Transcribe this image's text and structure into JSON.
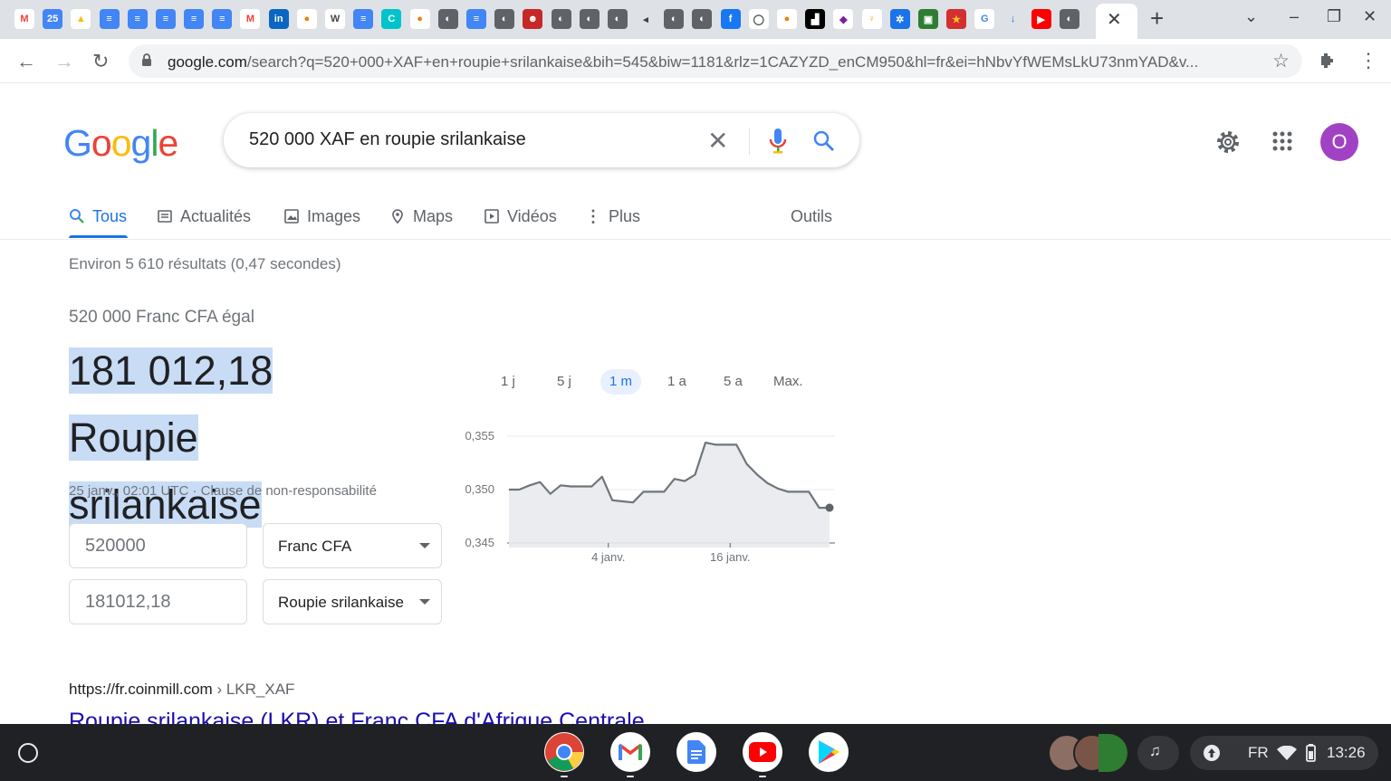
{
  "browser": {
    "url_host": "google.com",
    "url_rest": "/search?q=520+000+XAF+en+roupie+srilankaise&bih=545&biw=1181&rlz=1CAZYZD_enCM950&hl=fr&ei=hNbvYfWEMsLkU73nmYAD&v...",
    "favicons": [
      "gmail-icon",
      "calendar-icon",
      "drive-icon",
      "docs-icon",
      "docs-icon",
      "docs-icon",
      "docs-icon",
      "docs-icon",
      "gmail-icon",
      "linkedin-icon",
      "app-icon",
      "wordpress-icon",
      "docs-icon",
      "canva-icon",
      "app-icon",
      "globe-icon",
      "docs-icon",
      "globe-icon",
      "ghost-icon",
      "globe-icon",
      "globe-icon",
      "globe-icon",
      "audio-icon",
      "globe-icon",
      "globe-icon",
      "facebook-icon",
      "cycle-icon",
      "app-icon",
      "puzzle-icon",
      "diamond-icon",
      "figure-icon",
      "gear-icon",
      "photo-icon",
      "flag-icon",
      "google-icon",
      "download-icon",
      "youtube-icon",
      "globe-icon"
    ]
  },
  "search": {
    "logo": "Google",
    "query": "520 000 XAF en roupie srilankaise",
    "avatar_letter": "O",
    "tabs": [
      {
        "label": "Tous",
        "icon": "search-icon"
      },
      {
        "label": "Actualités",
        "icon": "news-icon"
      },
      {
        "label": "Images",
        "icon": "image-icon"
      },
      {
        "label": "Maps",
        "icon": "map-pin-icon"
      },
      {
        "label": "Vidéos",
        "icon": "video-icon"
      },
      {
        "label": "Plus",
        "icon": "more-icon"
      }
    ],
    "tools": "Outils",
    "stats": "Environ 5 610 résultats (0,47 secondes)"
  },
  "converter": {
    "equals_text": "520 000 Franc CFA égal",
    "result_line1": "181 012,18 Roupie",
    "result_line2": "srilankaise",
    "timestamp": "25 janv., 02:01 UTC · Clause de non-responsabilité",
    "from_amount": "520000",
    "from_currency": "Franc CFA",
    "to_amount": "181012,18",
    "to_currency": "Roupie srilankaise",
    "periods": [
      "1 j",
      "5 j",
      "1 m",
      "1 a",
      "5 a",
      "Max."
    ],
    "selected_period": "1 m"
  },
  "chart_data": {
    "type": "area",
    "y_ticks": [
      "0,355",
      "0,350",
      "0,345"
    ],
    "x_ticks": [
      "4 janv.",
      "16 janv."
    ],
    "ylim": [
      0.345,
      0.355
    ],
    "values": [
      0.35,
      0.35,
      0.3504,
      0.3507,
      0.3496,
      0.3504,
      0.3503,
      0.3503,
      0.3503,
      0.3512,
      0.349,
      0.3489,
      0.3488,
      0.3498,
      0.3498,
      0.3498,
      0.351,
      0.3508,
      0.3514,
      0.3544,
      0.3542,
      0.3542,
      0.3542,
      0.3524,
      0.3514,
      0.3506,
      0.3501,
      0.3498,
      0.3498,
      0.3498,
      0.3483,
      0.3483
    ],
    "colors": {
      "line": "#70757a",
      "fill": "#e8eaed",
      "grid": "#ebebeb"
    }
  },
  "web_result": {
    "url": "https://fr.coinmill.com",
    "crumb": " › LKR_XAF",
    "title": "Roupie srilankaise (LKR) et Franc CFA d'Afrique Centrale"
  },
  "shelf": {
    "apps": [
      "chrome-icon",
      "gmail-icon",
      "docs-icon",
      "youtube-icon",
      "play-store-icon"
    ],
    "lang": "FR",
    "time": "13:26"
  }
}
